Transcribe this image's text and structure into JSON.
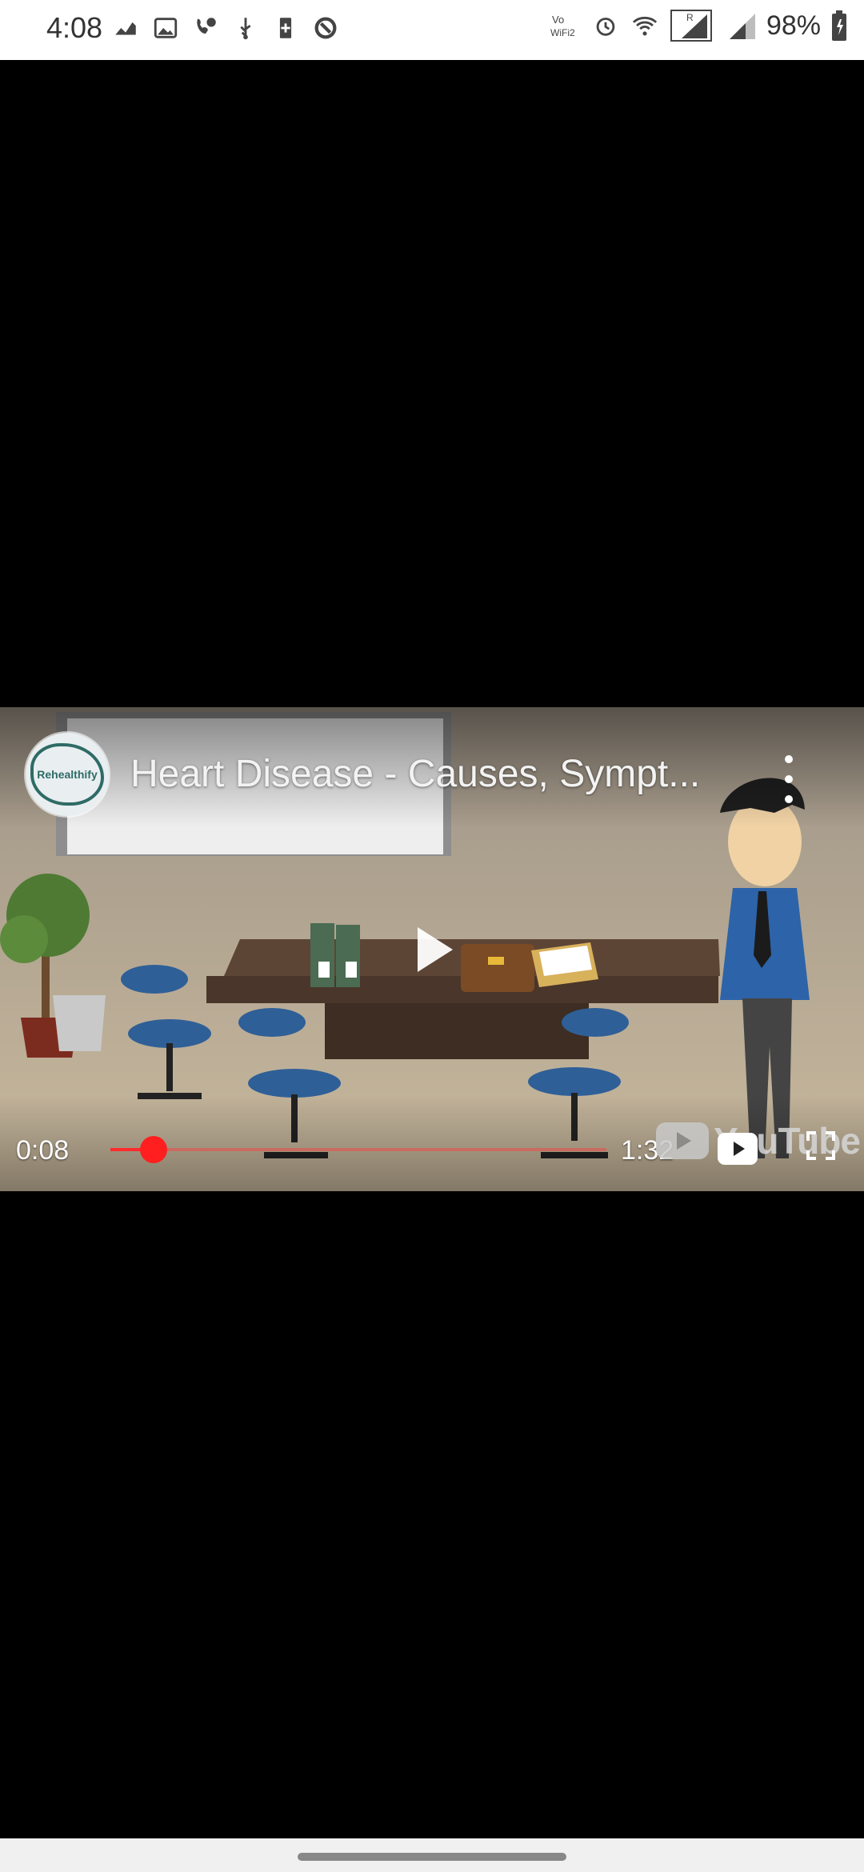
{
  "status_bar": {
    "time": "4:08",
    "wifi_label": "Vo WiFi2",
    "battery_percent": "98%",
    "left_icons": [
      "analytics-icon",
      "image-icon",
      "call-icon",
      "usb-icon",
      "battery-saver-icon",
      "vpn-icon"
    ],
    "right_icons": [
      "vowifi-icon",
      "alarm-icon",
      "wifi-icon",
      "signal-sim1-icon",
      "signal-sim2-icon",
      "battery-icon"
    ]
  },
  "player": {
    "channel_name": "Rehealthify",
    "title": "Heart Disease - Causes, Sympt...",
    "current_time": "0:08",
    "total_time": "1:32",
    "progress_fraction": 0.087,
    "watermark": "YouTube",
    "accent_color": "#ff2b2b"
  }
}
